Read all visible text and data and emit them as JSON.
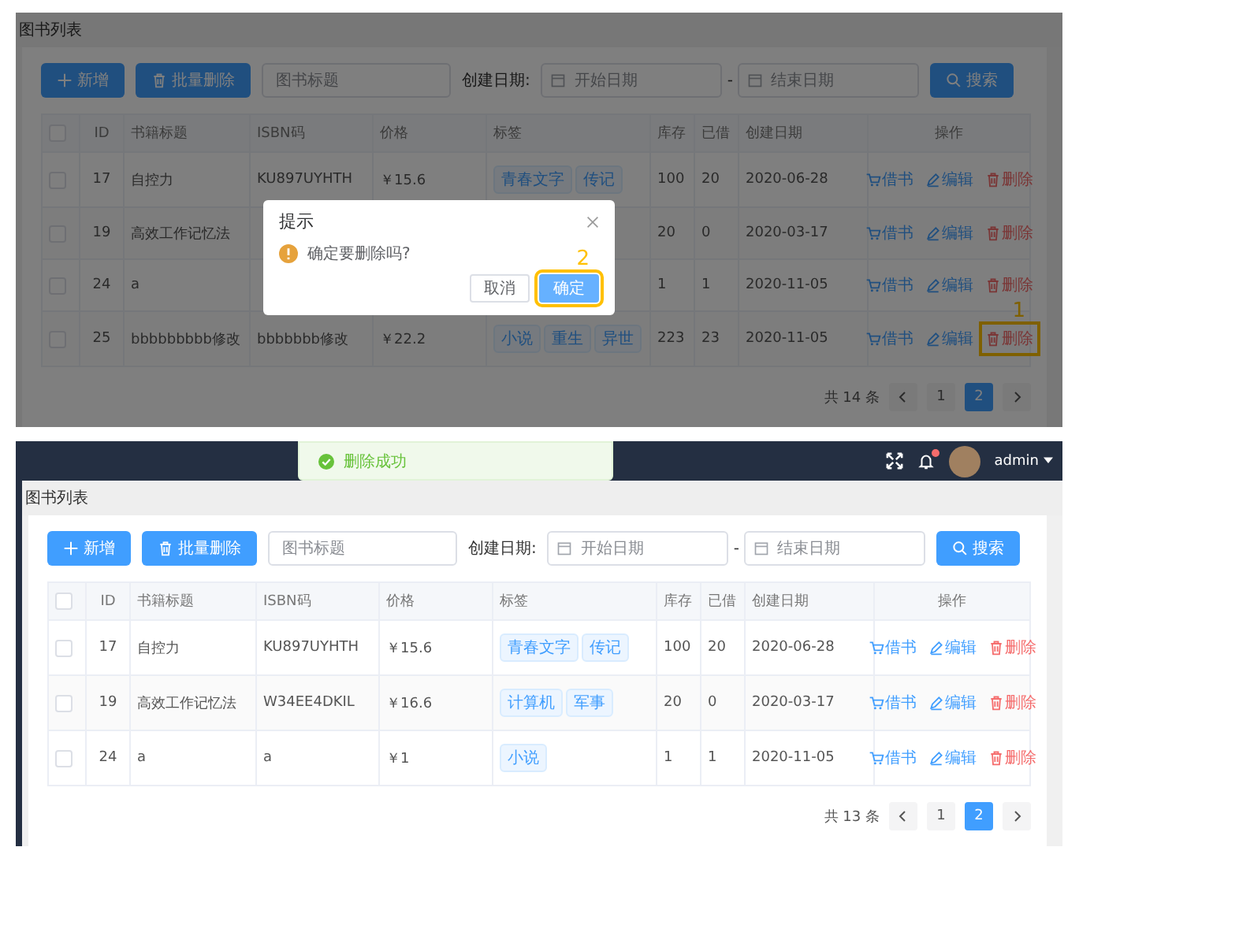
{
  "screenshots": [
    {
      "breadcrumb": "图书列表",
      "toolbar": {
        "add": "新增",
        "batch_delete": "批量删除",
        "title_placeholder": "图书标题",
        "date_label": "创建日期:",
        "start_placeholder": "开始日期",
        "separator": "-",
        "end_placeholder": "结束日期",
        "search": "搜索"
      },
      "table": {
        "select_all_checked": false,
        "columns": [
          "ID",
          "书籍标题",
          "ISBN码",
          "价格",
          "标签",
          "库存",
          "已借",
          "创建日期",
          "操作"
        ],
        "rows": [
          {
            "checked": false,
            "id": "17",
            "title": "自控力",
            "isbn": "KU897UYHTH",
            "price": "￥15.6",
            "tags": [
              "青春文字",
              "传记"
            ],
            "stock": "100",
            "borrowed": "20",
            "date": "2020-06-28",
            "actions": [
              {
                "kind": "borrow",
                "label": "借书"
              },
              {
                "kind": "edit",
                "label": "编辑"
              },
              {
                "kind": "delete",
                "label": "删除"
              }
            ]
          },
          {
            "checked": false,
            "id": "19",
            "title": "高效工作记忆法",
            "stock": "20",
            "borrowed": "0",
            "date": "2020-03-17",
            "actions": [
              {
                "kind": "borrow",
                "label": "借书"
              },
              {
                "kind": "edit",
                "label": "编辑"
              },
              {
                "kind": "delete",
                "label": "删除"
              }
            ]
          },
          {
            "checked": false,
            "id": "24",
            "title": "a",
            "stock": "1",
            "borrowed": "1",
            "date": "2020-11-05",
            "actions": [
              {
                "kind": "borrow",
                "label": "借书"
              },
              {
                "kind": "edit",
                "label": "编辑"
              },
              {
                "kind": "delete",
                "label": "删除"
              }
            ]
          },
          {
            "checked": false,
            "id": "25",
            "title": "bbbbbbbbb修改",
            "isbn": "bbbbbbb修改",
            "price": "￥22.2",
            "tags": [
              "小说",
              "重生",
              "异世"
            ],
            "stock": "223",
            "borrowed": "23",
            "date": "2020-11-05",
            "actions": [
              {
                "kind": "borrow",
                "label": "借书"
              },
              {
                "kind": "edit",
                "label": "编辑"
              },
              {
                "kind": "delete",
                "label": "删除",
                "marker": "1"
              }
            ]
          }
        ]
      },
      "pagination": {
        "total": "共 14 条",
        "pages": [
          {
            "label": "1",
            "selected": false
          },
          {
            "label": "2",
            "selected": true
          }
        ]
      },
      "dialog": {
        "title": "提示",
        "message": "确定要删除吗?",
        "cancel": "取消",
        "confirm": "确定",
        "confirm_marker": "2"
      }
    },
    {
      "header": {
        "user": "admin",
        "has_notification": true
      },
      "toast": {
        "message": "删除成功"
      },
      "breadcrumb": "图书列表",
      "toolbar": {
        "add": "新增",
        "batch_delete": "批量删除",
        "title_placeholder": "图书标题",
        "date_label": "创建日期:",
        "start_placeholder": "开始日期",
        "separator": "-",
        "end_placeholder": "结束日期",
        "search": "搜索"
      },
      "table": {
        "select_all_checked": false,
        "columns": [
          "ID",
          "书籍标题",
          "ISBN码",
          "价格",
          "标签",
          "库存",
          "已借",
          "创建日期",
          "操作"
        ],
        "rows": [
          {
            "checked": false,
            "id": "17",
            "title": "自控力",
            "isbn": "KU897UYHTH",
            "price": "￥15.6",
            "tags": [
              "青春文字",
              "传记"
            ],
            "stock": "100",
            "borrowed": "20",
            "date": "2020-06-28",
            "actions": [
              {
                "kind": "borrow",
                "label": "借书"
              },
              {
                "kind": "edit",
                "label": "编辑"
              },
              {
                "kind": "delete",
                "label": "删除"
              }
            ]
          },
          {
            "checked": false,
            "id": "19",
            "title": "高效工作记忆法",
            "isbn": "W34EE4DKIL",
            "price": "￥16.6",
            "tags": [
              "计算机",
              "军事"
            ],
            "stock": "20",
            "borrowed": "0",
            "date": "2020-03-17",
            "actions": [
              {
                "kind": "borrow",
                "label": "借书"
              },
              {
                "kind": "edit",
                "label": "编辑"
              },
              {
                "kind": "delete",
                "label": "删除"
              }
            ]
          },
          {
            "checked": false,
            "id": "24",
            "title": "a",
            "isbn": "a",
            "price": "￥1",
            "tags": [
              "小说"
            ],
            "stock": "1",
            "borrowed": "1",
            "date": "2020-11-05",
            "actions": [
              {
                "kind": "borrow",
                "label": "借书"
              },
              {
                "kind": "edit",
                "label": "编辑"
              },
              {
                "kind": "delete",
                "label": "删除"
              }
            ]
          }
        ]
      },
      "pagination": {
        "total": "共 13 条",
        "pages": [
          {
            "label": "1",
            "selected": false
          },
          {
            "label": "2",
            "selected": true
          }
        ]
      }
    }
  ]
}
